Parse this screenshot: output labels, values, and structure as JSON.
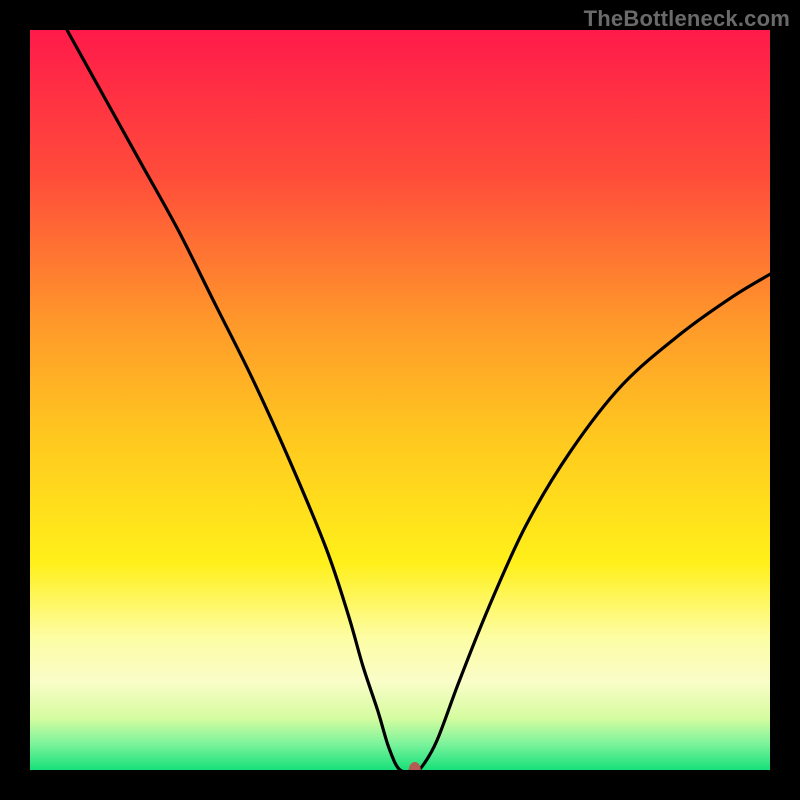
{
  "watermark": "TheBottleneck.com",
  "chart_data": {
    "type": "line",
    "title": "",
    "xlabel": "",
    "ylabel": "",
    "xlim": [
      0,
      100
    ],
    "ylim": [
      0,
      100
    ],
    "grid": false,
    "legend": false,
    "background_gradient": {
      "stops": [
        {
          "offset": 0.0,
          "color": "#ff1a4a"
        },
        {
          "offset": 0.2,
          "color": "#ff4d3a"
        },
        {
          "offset": 0.4,
          "color": "#ff9a2a"
        },
        {
          "offset": 0.55,
          "color": "#ffc81f"
        },
        {
          "offset": 0.72,
          "color": "#fff01a"
        },
        {
          "offset": 0.82,
          "color": "#fdfda3"
        },
        {
          "offset": 0.88,
          "color": "#fafdc8"
        },
        {
          "offset": 0.93,
          "color": "#d5fca0"
        },
        {
          "offset": 0.965,
          "color": "#7bf39b"
        },
        {
          "offset": 1.0,
          "color": "#16e07a"
        }
      ]
    },
    "series": [
      {
        "name": "curve",
        "x": [
          5,
          10,
          15,
          20,
          25,
          30,
          35,
          40,
          43,
          45,
          47,
          48.5,
          50,
          52,
          53,
          55,
          58,
          62,
          67,
          73,
          80,
          88,
          95,
          100
        ],
        "y": [
          100,
          91,
          82,
          73,
          63,
          53,
          42,
          30,
          21,
          14,
          8,
          3,
          0,
          0,
          0.5,
          4,
          12,
          22,
          33,
          43,
          52,
          59,
          64,
          67
        ]
      }
    ],
    "markers": [
      {
        "name": "minimum-point",
        "x": 52,
        "y": 0,
        "color": "#b55a54",
        "rx": 6,
        "ry": 8
      }
    ]
  }
}
